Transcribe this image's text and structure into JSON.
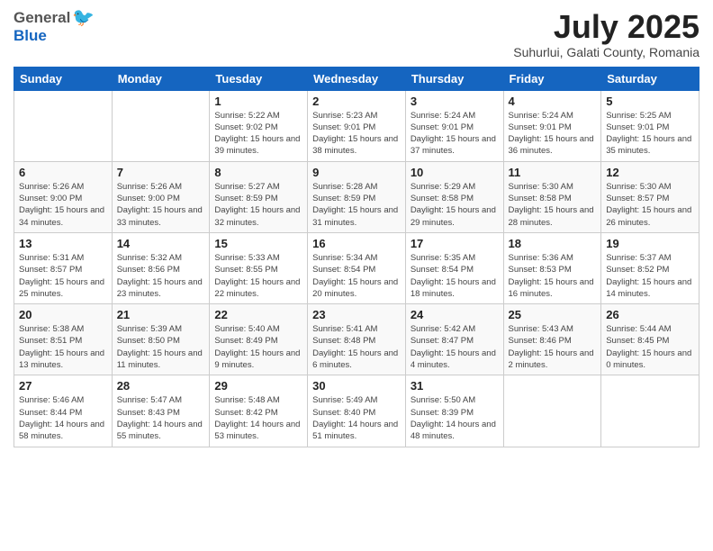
{
  "header": {
    "logo_general": "General",
    "logo_blue": "Blue",
    "month_title": "July 2025",
    "subtitle": "Suhurlui, Galati County, Romania"
  },
  "weekdays": [
    "Sunday",
    "Monday",
    "Tuesday",
    "Wednesday",
    "Thursday",
    "Friday",
    "Saturday"
  ],
  "weeks": [
    [
      {
        "day": "",
        "info": ""
      },
      {
        "day": "",
        "info": ""
      },
      {
        "day": "1",
        "info": "Sunrise: 5:22 AM\nSunset: 9:02 PM\nDaylight: 15 hours and 39 minutes."
      },
      {
        "day": "2",
        "info": "Sunrise: 5:23 AM\nSunset: 9:01 PM\nDaylight: 15 hours and 38 minutes."
      },
      {
        "day": "3",
        "info": "Sunrise: 5:24 AM\nSunset: 9:01 PM\nDaylight: 15 hours and 37 minutes."
      },
      {
        "day": "4",
        "info": "Sunrise: 5:24 AM\nSunset: 9:01 PM\nDaylight: 15 hours and 36 minutes."
      },
      {
        "day": "5",
        "info": "Sunrise: 5:25 AM\nSunset: 9:01 PM\nDaylight: 15 hours and 35 minutes."
      }
    ],
    [
      {
        "day": "6",
        "info": "Sunrise: 5:26 AM\nSunset: 9:00 PM\nDaylight: 15 hours and 34 minutes."
      },
      {
        "day": "7",
        "info": "Sunrise: 5:26 AM\nSunset: 9:00 PM\nDaylight: 15 hours and 33 minutes."
      },
      {
        "day": "8",
        "info": "Sunrise: 5:27 AM\nSunset: 8:59 PM\nDaylight: 15 hours and 32 minutes."
      },
      {
        "day": "9",
        "info": "Sunrise: 5:28 AM\nSunset: 8:59 PM\nDaylight: 15 hours and 31 minutes."
      },
      {
        "day": "10",
        "info": "Sunrise: 5:29 AM\nSunset: 8:58 PM\nDaylight: 15 hours and 29 minutes."
      },
      {
        "day": "11",
        "info": "Sunrise: 5:30 AM\nSunset: 8:58 PM\nDaylight: 15 hours and 28 minutes."
      },
      {
        "day": "12",
        "info": "Sunrise: 5:30 AM\nSunset: 8:57 PM\nDaylight: 15 hours and 26 minutes."
      }
    ],
    [
      {
        "day": "13",
        "info": "Sunrise: 5:31 AM\nSunset: 8:57 PM\nDaylight: 15 hours and 25 minutes."
      },
      {
        "day": "14",
        "info": "Sunrise: 5:32 AM\nSunset: 8:56 PM\nDaylight: 15 hours and 23 minutes."
      },
      {
        "day": "15",
        "info": "Sunrise: 5:33 AM\nSunset: 8:55 PM\nDaylight: 15 hours and 22 minutes."
      },
      {
        "day": "16",
        "info": "Sunrise: 5:34 AM\nSunset: 8:54 PM\nDaylight: 15 hours and 20 minutes."
      },
      {
        "day": "17",
        "info": "Sunrise: 5:35 AM\nSunset: 8:54 PM\nDaylight: 15 hours and 18 minutes."
      },
      {
        "day": "18",
        "info": "Sunrise: 5:36 AM\nSunset: 8:53 PM\nDaylight: 15 hours and 16 minutes."
      },
      {
        "day": "19",
        "info": "Sunrise: 5:37 AM\nSunset: 8:52 PM\nDaylight: 15 hours and 14 minutes."
      }
    ],
    [
      {
        "day": "20",
        "info": "Sunrise: 5:38 AM\nSunset: 8:51 PM\nDaylight: 15 hours and 13 minutes."
      },
      {
        "day": "21",
        "info": "Sunrise: 5:39 AM\nSunset: 8:50 PM\nDaylight: 15 hours and 11 minutes."
      },
      {
        "day": "22",
        "info": "Sunrise: 5:40 AM\nSunset: 8:49 PM\nDaylight: 15 hours and 9 minutes."
      },
      {
        "day": "23",
        "info": "Sunrise: 5:41 AM\nSunset: 8:48 PM\nDaylight: 15 hours and 6 minutes."
      },
      {
        "day": "24",
        "info": "Sunrise: 5:42 AM\nSunset: 8:47 PM\nDaylight: 15 hours and 4 minutes."
      },
      {
        "day": "25",
        "info": "Sunrise: 5:43 AM\nSunset: 8:46 PM\nDaylight: 15 hours and 2 minutes."
      },
      {
        "day": "26",
        "info": "Sunrise: 5:44 AM\nSunset: 8:45 PM\nDaylight: 15 hours and 0 minutes."
      }
    ],
    [
      {
        "day": "27",
        "info": "Sunrise: 5:46 AM\nSunset: 8:44 PM\nDaylight: 14 hours and 58 minutes."
      },
      {
        "day": "28",
        "info": "Sunrise: 5:47 AM\nSunset: 8:43 PM\nDaylight: 14 hours and 55 minutes."
      },
      {
        "day": "29",
        "info": "Sunrise: 5:48 AM\nSunset: 8:42 PM\nDaylight: 14 hours and 53 minutes."
      },
      {
        "day": "30",
        "info": "Sunrise: 5:49 AM\nSunset: 8:40 PM\nDaylight: 14 hours and 51 minutes."
      },
      {
        "day": "31",
        "info": "Sunrise: 5:50 AM\nSunset: 8:39 PM\nDaylight: 14 hours and 48 minutes."
      },
      {
        "day": "",
        "info": ""
      },
      {
        "day": "",
        "info": ""
      }
    ]
  ]
}
